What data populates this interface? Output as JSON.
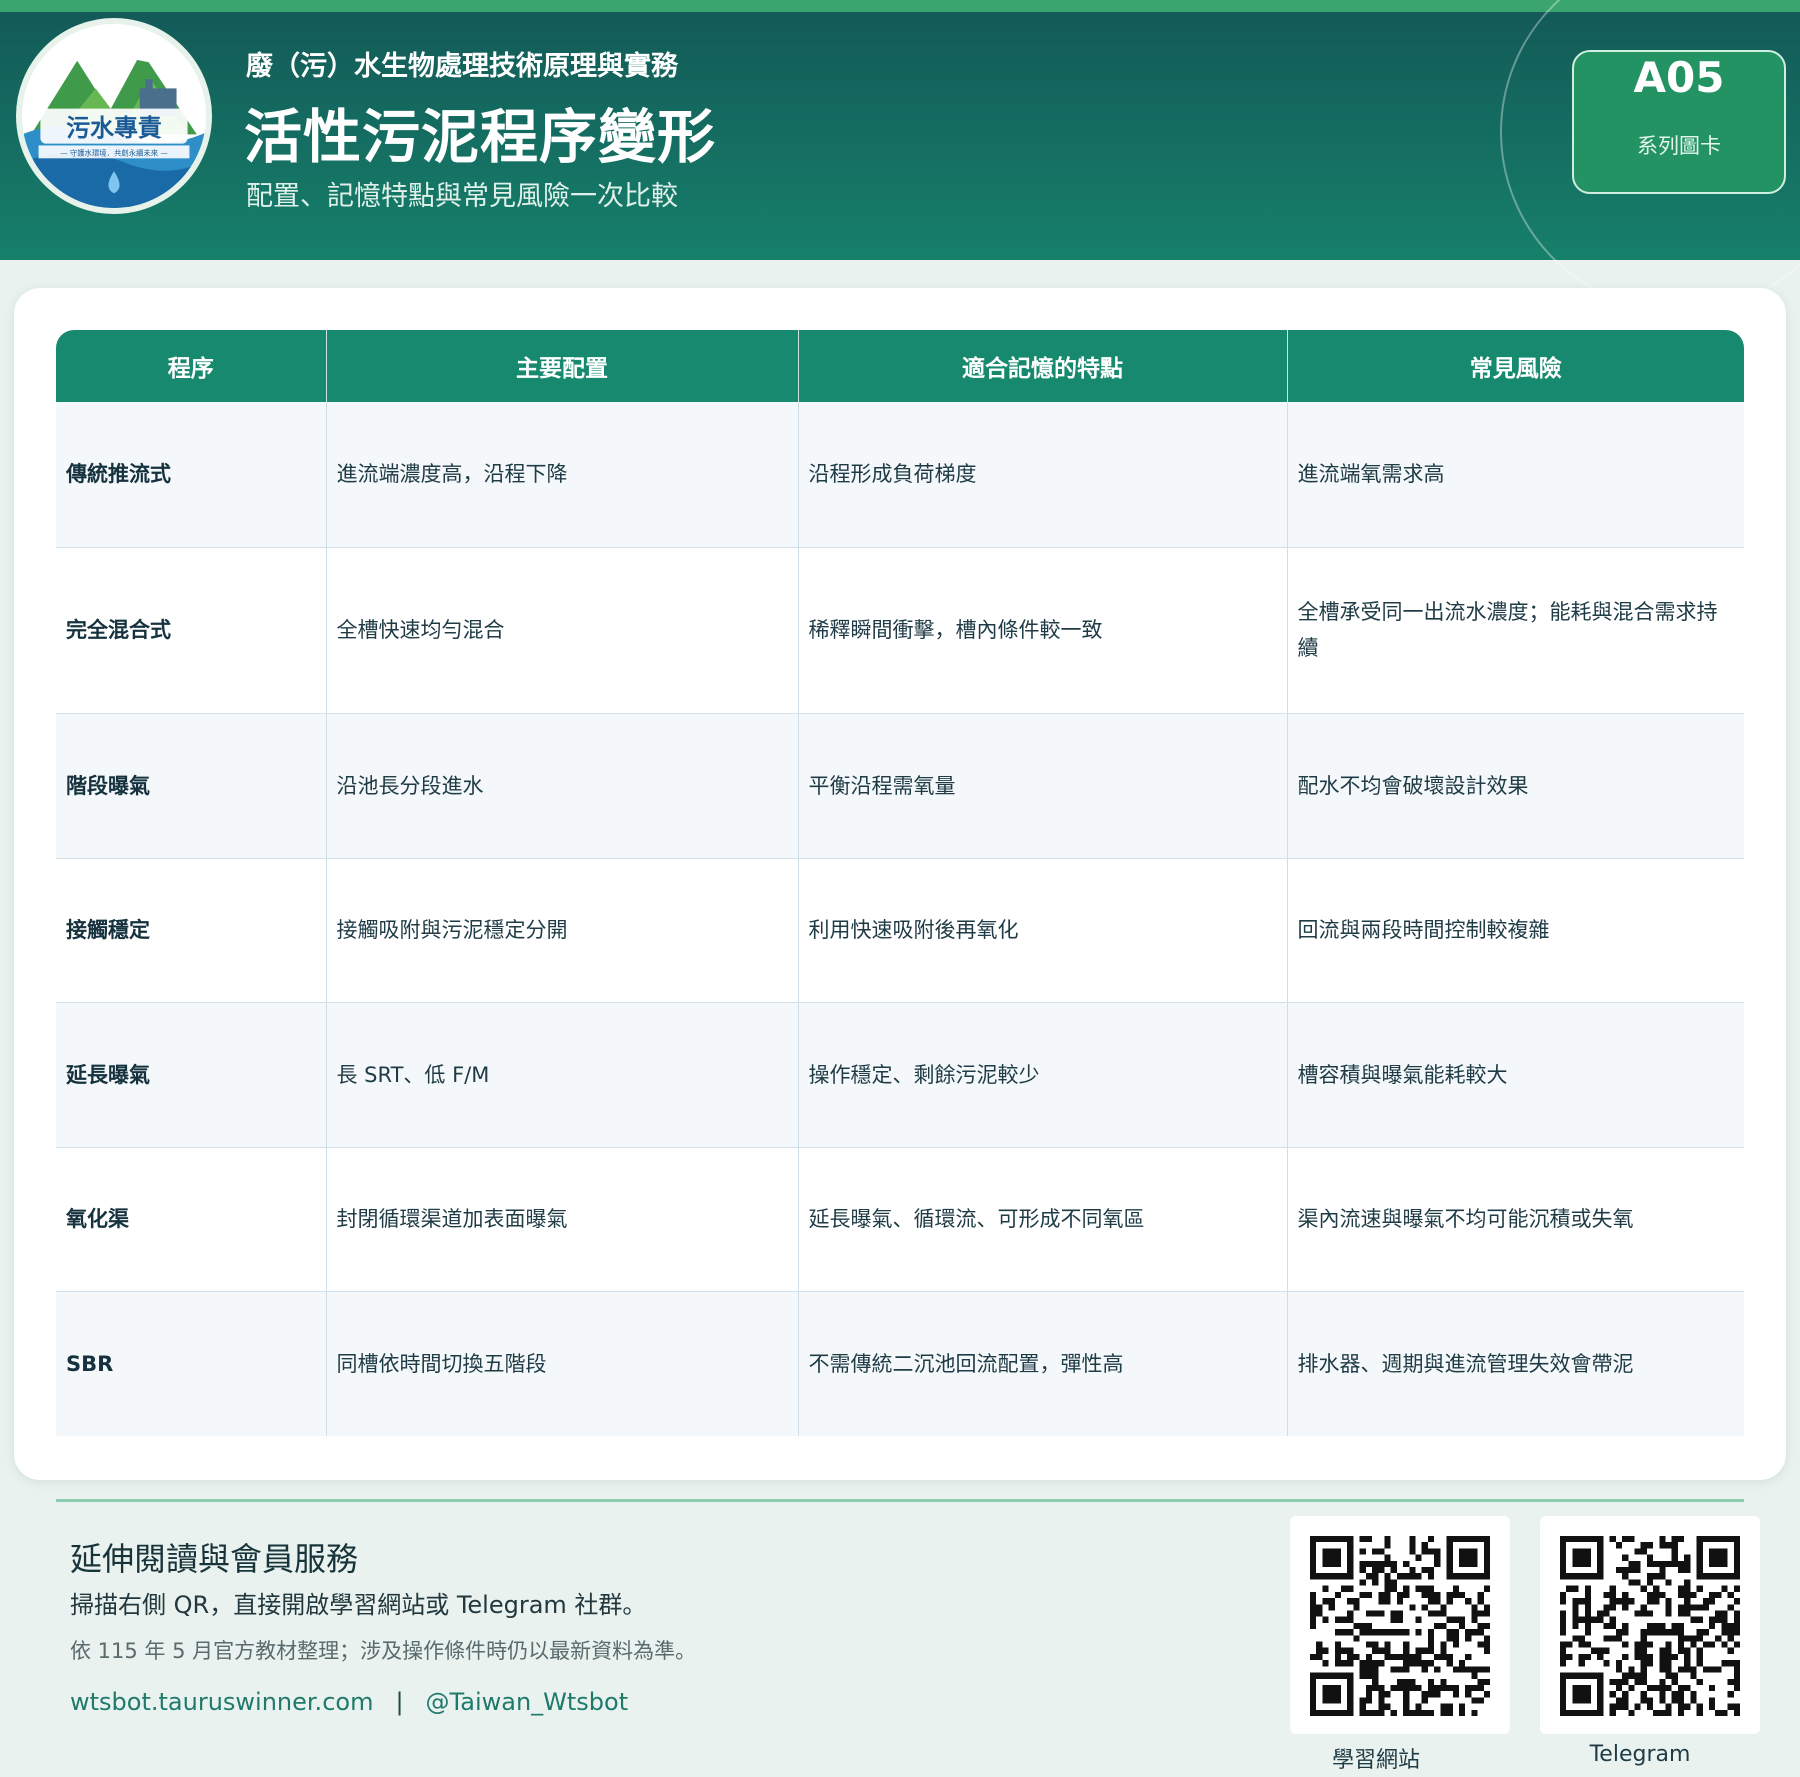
{
  "header": {
    "logo_text": "污水專責",
    "logo_subtext": "— 守護水環境．共創永續未來 —",
    "eyebrow": "廢（污）水生物處理技術原理與實務",
    "title": "活性污泥程序變形",
    "subtitle": "配置、記憶特點與常見風險一次比較",
    "badge_code": "A05",
    "badge_label": "系列圖卡"
  },
  "table": {
    "headers": [
      "程序",
      "主要配置",
      "適合記憶的特點",
      "常見風險"
    ],
    "rows": [
      [
        "傳統推流式",
        "進流端濃度高，沿程下降",
        "沿程形成負荷梯度",
        "進流端氧需求高"
      ],
      [
        "完全混合式",
        "全槽快速均勻混合",
        "稀釋瞬間衝擊，槽內條件較一致",
        "全槽承受同一出流水濃度；能耗與混合需求持續"
      ],
      [
        "階段曝氣",
        "沿池長分段進水",
        "平衡沿程需氧量",
        "配水不均會破壞設計效果"
      ],
      [
        "接觸穩定",
        "接觸吸附與污泥穩定分開",
        "利用快速吸附後再氧化",
        "回流與兩段時間控制較複雜"
      ],
      [
        "延長曝氣",
        "長 SRT、低 F/M",
        "操作穩定、剩餘污泥較少",
        "槽容積與曝氣能耗較大"
      ],
      [
        "氧化渠",
        "封閉循環渠道加表面曝氣",
        "延長曝氣、循環流、可形成不同氧區",
        "渠內流速與曝氣不均可能沉積或失氧"
      ],
      [
        "SBR",
        "同槽依時間切換五階段",
        "不需傳統二沉池回流配置，彈性高",
        "排水器、週期與進流管理失效會帶泥"
      ]
    ]
  },
  "footer": {
    "title": "延伸閱讀與會員服務",
    "line1": "掃描右側 QR，直接開啟學習網站或 Telegram 社群。",
    "line2": "依 115 年 5 月官方教材整理；涉及操作條件時仍以最新資料為準。",
    "website": "wtsbot.tauruswinner.com",
    "separator": "|",
    "telegram": "@Taiwan_Wtsbot",
    "qr_website_label": "學習網站",
    "qr_telegram_label": "Telegram"
  },
  "colors": {
    "header_top": "#135a58",
    "header_bottom": "#16806a",
    "accent_green": "#3aa56e",
    "table_header": "#17896e",
    "link": "#1f7a6c"
  },
  "icons": [
    "logo-emblem",
    "qr-code-website",
    "qr-code-telegram"
  ]
}
